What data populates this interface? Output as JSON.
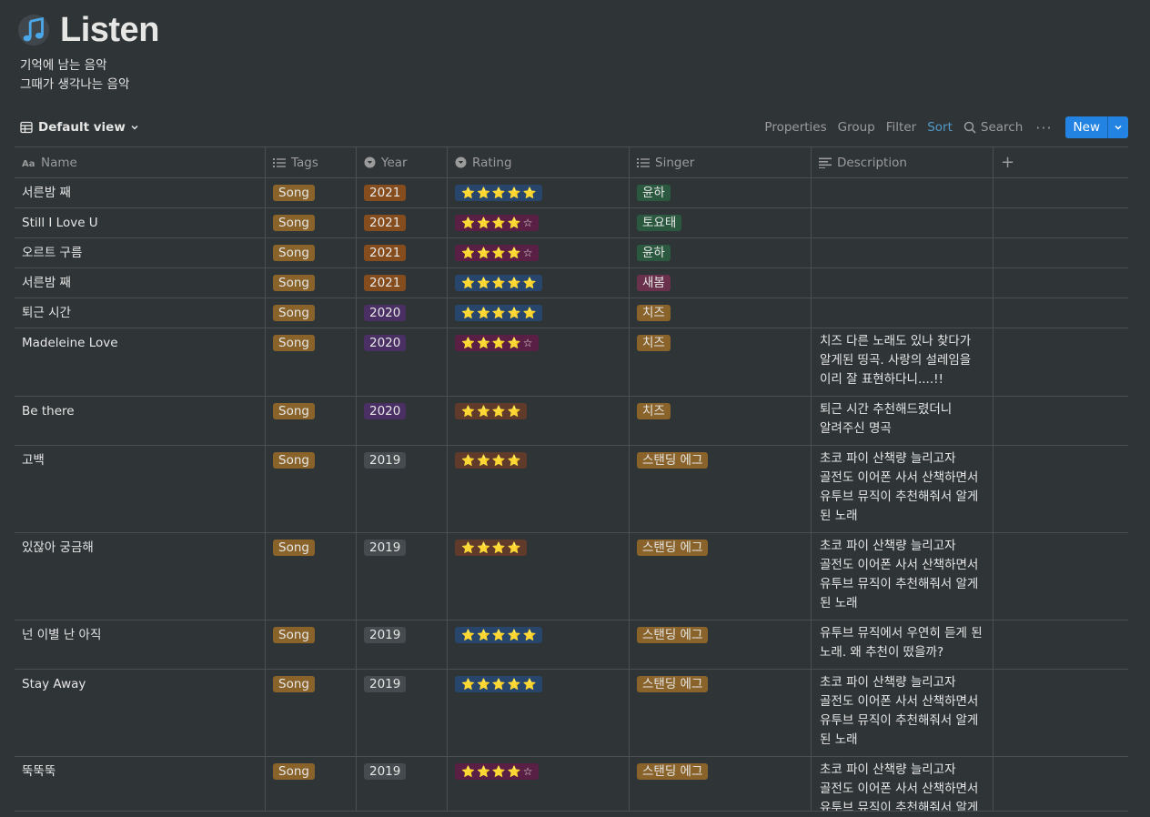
{
  "page": {
    "title": "Listen",
    "logo_icon": "music-note-icon",
    "description_lines": [
      "기억에 남는 음악",
      "그때가 생각나는 음악"
    ]
  },
  "toolbar": {
    "view_label": "Default view",
    "properties": "Properties",
    "group": "Group",
    "filter": "Filter",
    "sort": "Sort",
    "search": "Search",
    "more": "···",
    "new": "New"
  },
  "columns": {
    "name": "Name",
    "tags": "Tags",
    "year": "Year",
    "rating": "Rating",
    "singer": "Singer",
    "description": "Description",
    "add": "+"
  },
  "colors": {
    "accent": "#2383e2",
    "sort_active": "#529cca",
    "background": "#2f3437"
  },
  "rows": [
    {
      "name": "서른밤 째",
      "tag": "Song",
      "year": "2021",
      "rating": "⭐⭐⭐⭐⭐",
      "singer": "윤하",
      "description": ""
    },
    {
      "name": "Still I Love U",
      "tag": "Song",
      "year": "2021",
      "rating": "⭐⭐⭐⭐☆",
      "singer": "토요태",
      "description": ""
    },
    {
      "name": "오르트 구름",
      "tag": "Song",
      "year": "2021",
      "rating": "⭐⭐⭐⭐☆",
      "singer": "윤하",
      "description": ""
    },
    {
      "name": "서른밤 째",
      "tag": "Song",
      "year": "2021",
      "rating": "⭐⭐⭐⭐⭐",
      "singer": "새봄",
      "description": ""
    },
    {
      "name": "퇴근 시간",
      "tag": "Song",
      "year": "2020",
      "rating": "⭐⭐⭐⭐⭐",
      "singer": "치즈",
      "description": ""
    },
    {
      "name": "Madeleine Love",
      "tag": "Song",
      "year": "2020",
      "rating": "⭐⭐⭐⭐☆",
      "singer": "치즈",
      "description": "치즈 다른 노래도 있나 찾다가 알게된 띵곡. 사랑의 설레임을 이리 잘 표현하다니....!!"
    },
    {
      "name": "Be there",
      "tag": "Song",
      "year": "2020",
      "rating": "⭐⭐⭐⭐",
      "singer": "치즈",
      "description": "퇴근 시간 추천해드렸더니 알려주신  명곡"
    },
    {
      "name": "고백",
      "tag": "Song",
      "year": "2019",
      "rating": "⭐⭐⭐⭐",
      "singer": "스탠딩 에그",
      "description": "초코 파이 산책량 늘리고자 골전도 이어폰 사서 산책하면서 유투브 뮤직이 추천해줘서 알게 된 노래"
    },
    {
      "name": "있잖아 궁금해",
      "tag": "Song",
      "year": "2019",
      "rating": "⭐⭐⭐⭐",
      "singer": "스탠딩 에그",
      "description": "초코 파이 산책량 늘리고자 골전도 이어폰 사서 산책하면서 유투브 뮤직이 추천해줘서 알게 된 노래"
    },
    {
      "name": "넌 이별 난 아직",
      "tag": "Song",
      "year": "2019",
      "rating": "⭐⭐⭐⭐⭐",
      "singer": "스탠딩 에그",
      "description": "유투브 뮤직에서 우연히 듣게 된 노래. 왜 추천이 떴을까?"
    },
    {
      "name": "Stay Away",
      "tag": "Song",
      "year": "2019",
      "rating": "⭐⭐⭐⭐⭐",
      "singer": "스탠딩 에그",
      "description": "초코 파이 산책량 늘리고자 골전도 이어폰 사서 산책하면서 유투브 뮤직이 추천해줘서 알게 된 노래"
    },
    {
      "name": "뚝뚝뚝",
      "tag": "Song",
      "year": "2019",
      "rating": "⭐⭐⭐⭐☆",
      "singer": "스탠딩 에그",
      "description": "초코 파이 산책량 늘리고자 골전도 이어폰 사서 산책하면서 유투브 뮤직이 추천해줘서 알게 된 노래"
    }
  ]
}
